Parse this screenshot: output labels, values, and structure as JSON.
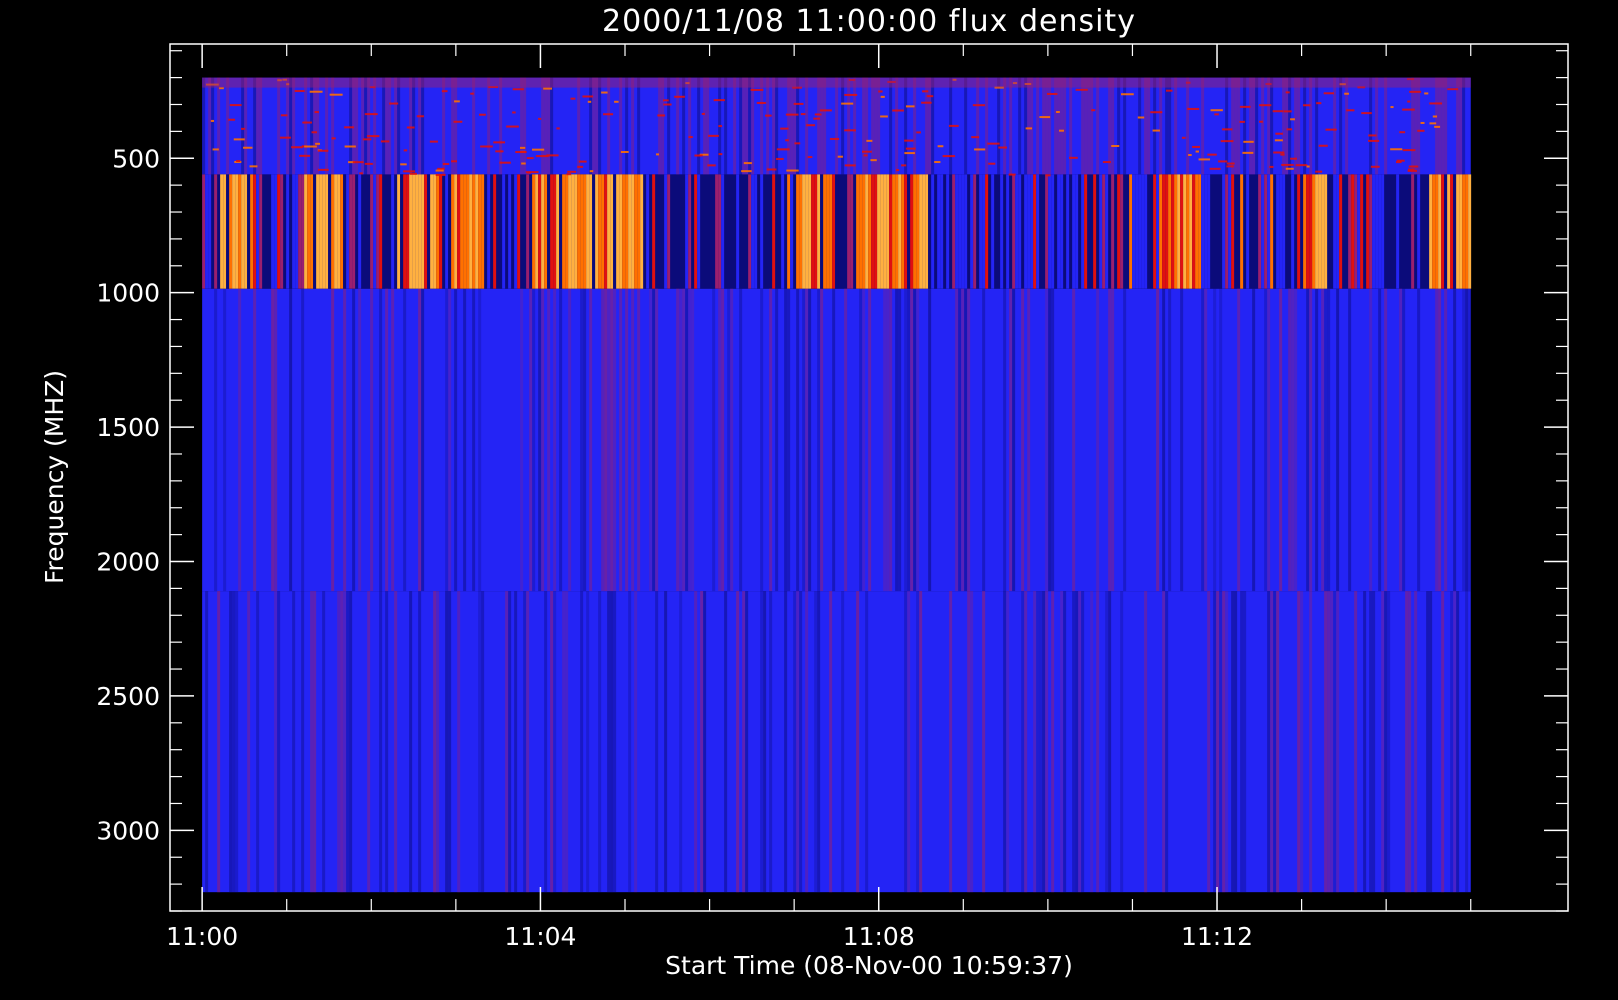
{
  "chart_data": {
    "type": "heatmap",
    "title": "2000/11/08 11:00:00 flux density",
    "xlabel": "Start Time (08-Nov-00 10:59:37)",
    "ylabel": "Frequency (MHZ)",
    "x_ticks": [
      "11:00",
      "11:04",
      "11:08",
      "11:12"
    ],
    "x_range_minutes": [
      -0.38,
      16.15
    ],
    "data_range_minutes": [
      0,
      15
    ],
    "y_ticks": [
      500,
      1000,
      1500,
      2000,
      2500,
      3000
    ],
    "ylim": [
      3300,
      75
    ],
    "y_data_range": [
      3230,
      200
    ],
    "y_inverted": true,
    "bands": [
      {
        "name": "high",
        "from": 2110,
        "to": 3230,
        "level": "low"
      },
      {
        "name": "mid",
        "from": 985,
        "to": 2110,
        "level": "low"
      },
      {
        "name": "burst",
        "from": 560,
        "to": 985,
        "level": "bursty"
      },
      {
        "name": "top",
        "from": 200,
        "to": 560,
        "level": "noisy"
      }
    ],
    "burst_clusters_minutes": [
      {
        "start": 0.2,
        "end": 0.6
      },
      {
        "start": 1.2,
        "end": 1.7
      },
      {
        "start": 2.3,
        "end": 2.8
      },
      {
        "start": 2.9,
        "end": 3.3
      },
      {
        "start": 3.9,
        "end": 4.2
      },
      {
        "start": 4.0,
        "end": 5.2
      },
      {
        "start": 7.0,
        "end": 7.5
      },
      {
        "start": 7.7,
        "end": 8.6
      },
      {
        "start": 11.3,
        "end": 11.8
      },
      {
        "start": 13.0,
        "end": 13.3
      },
      {
        "start": 14.5,
        "end": 15.0
      }
    ],
    "colors": {
      "background": "#000000",
      "axes": "#ffffff",
      "base": "#2424f5",
      "dark": "#0b0b7a",
      "mid": "#9a1f6e",
      "hot": "#e01010",
      "hotter": "#ff7000",
      "hottest": "#ffb040"
    }
  }
}
